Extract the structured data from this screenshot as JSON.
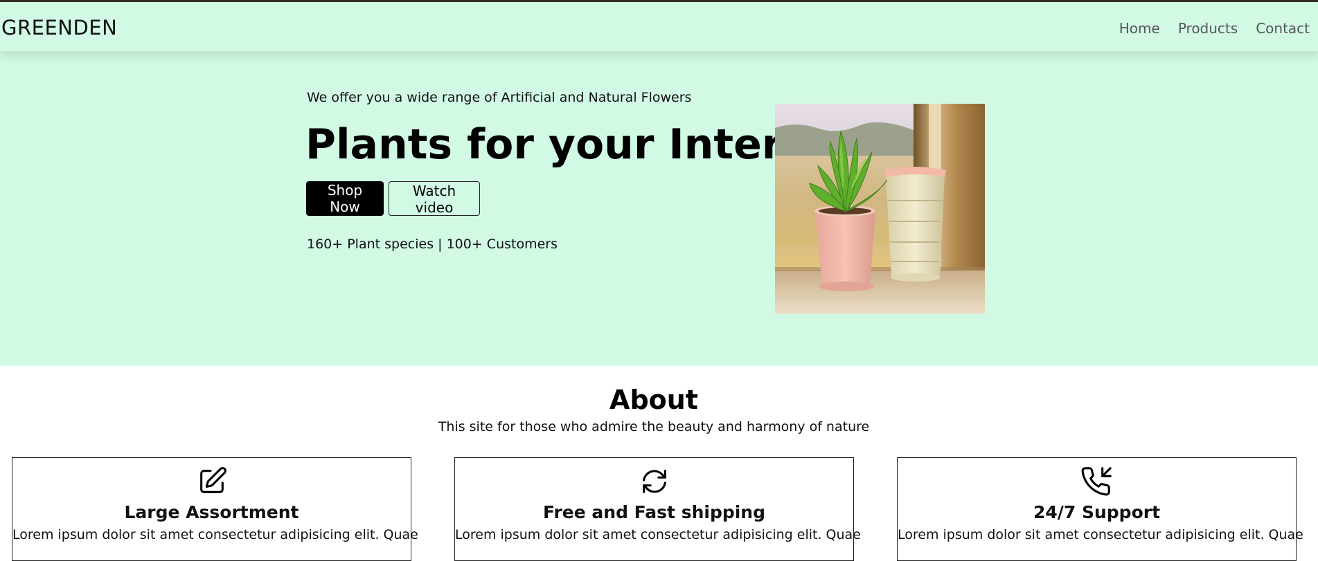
{
  "brand": "GREENDEN",
  "nav": {
    "items": [
      {
        "label": "Home"
      },
      {
        "label": "Products"
      },
      {
        "label": "Contact"
      }
    ]
  },
  "hero": {
    "subtitle": "We offer you a wide range of Artificial and Natural Flowers",
    "title": "Plants for your Interior",
    "shop_button": "Shop Now",
    "watch_button": "Watch video",
    "stats": "160+ Plant species | 100+ Customers"
  },
  "about": {
    "title": "About",
    "subtitle": "This site for those who admire the beauty and harmony of nature",
    "cards": [
      {
        "icon": "edit-icon",
        "title": "Large Assortment",
        "text": "Lorem ipsum dolor sit amet consectetur adipisicing elit. Quae"
      },
      {
        "icon": "refresh-icon",
        "title": "Free and Fast shipping",
        "text": "Lorem ipsum dolor sit amet consectetur adipisicing elit. Quae"
      },
      {
        "icon": "phone-incoming-icon",
        "title": "24/7 Support",
        "text": "Lorem ipsum dolor sit amet consectetur adipisicing elit. Quae"
      }
    ]
  },
  "colors": {
    "mint_background": "#d1f9e4",
    "primary_button": "#000000"
  }
}
